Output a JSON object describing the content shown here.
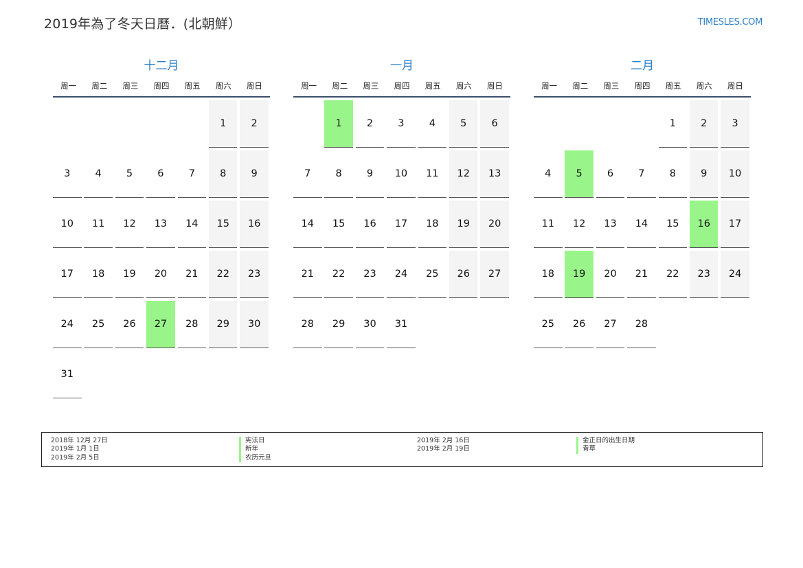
{
  "header": {
    "title": "2019年為了冬天日曆．(北朝鮮）",
    "site": "TIMESLES.COM"
  },
  "weekdays": [
    "周一",
    "周二",
    "周三",
    "周四",
    "周五",
    "周六",
    "周日"
  ],
  "colors": {
    "accent": "#2a7fc4",
    "holiday": "#99f58a",
    "weekend": "#f4f4f4",
    "rule": "#3b4f6b"
  },
  "months": [
    {
      "name": "十二月",
      "offset": 5,
      "days": [
        1,
        2,
        3,
        4,
        5,
        6,
        7,
        8,
        9,
        10,
        11,
        12,
        13,
        14,
        15,
        16,
        17,
        18,
        19,
        20,
        21,
        22,
        23,
        24,
        25,
        26,
        27,
        28,
        29,
        30,
        31
      ],
      "holidays": [
        27
      ]
    },
    {
      "name": "一月",
      "offset": 1,
      "days": [
        1,
        2,
        3,
        4,
        5,
        6,
        7,
        8,
        9,
        10,
        11,
        12,
        13,
        14,
        15,
        16,
        17,
        18,
        19,
        20,
        21,
        22,
        23,
        24,
        25,
        26,
        27,
        28,
        29,
        30,
        31
      ],
      "holidays": [
        1
      ]
    },
    {
      "name": "二月",
      "offset": 4,
      "days": [
        1,
        2,
        3,
        4,
        5,
        6,
        7,
        8,
        9,
        10,
        11,
        12,
        13,
        14,
        15,
        16,
        17,
        18,
        19,
        20,
        21,
        22,
        23,
        24,
        25,
        26,
        27,
        28
      ],
      "holidays": [
        5,
        16,
        19
      ]
    }
  ],
  "legend": {
    "left": [
      {
        "date": "2018年 12月 27日",
        "name": "宪法日"
      },
      {
        "date": "2019年 1月 1日",
        "name": "新年"
      },
      {
        "date": "2019年 2月 5日",
        "name": "农历元旦"
      }
    ],
    "right": [
      {
        "date": "2019年 2月 16日",
        "name": "金正日的出生日期"
      },
      {
        "date": "2019年 2月 19日",
        "name": "青草"
      }
    ]
  }
}
